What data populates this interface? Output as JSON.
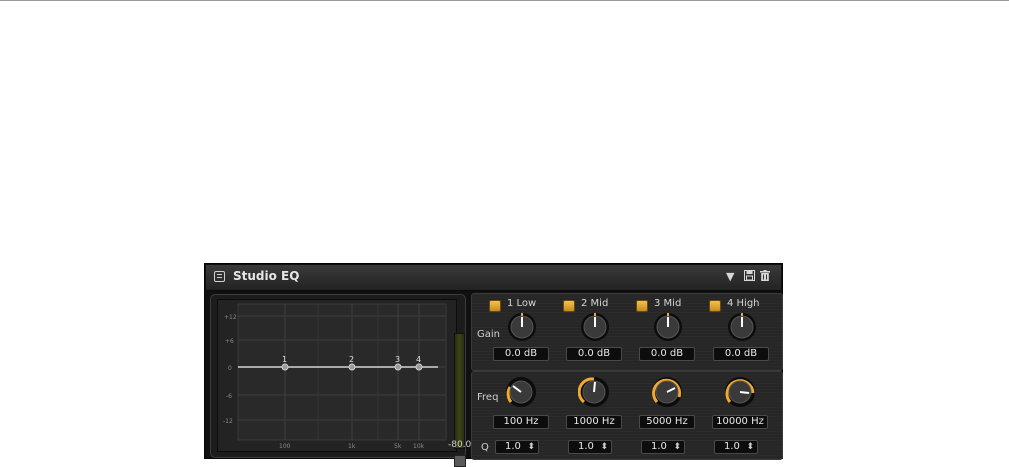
{
  "plugin": {
    "title": "Studio EQ",
    "icons": [
      "menu-icon",
      "dropdown-arrow-icon",
      "save-icon",
      "trash-icon"
    ]
  },
  "graph": {
    "db_labels": [
      "+12",
      "+6",
      "0",
      "-6",
      "-12"
    ],
    "freq_labels": [
      "100",
      "1k",
      "5k",
      "10k"
    ],
    "band_markers": [
      "1",
      "2",
      "3",
      "4"
    ],
    "meter_value": "-80.0"
  },
  "labels": {
    "gain": "Gain",
    "freq": "Freq",
    "q": "Q"
  },
  "bands": [
    {
      "name": "1 Low",
      "enabled": true,
      "gain": "0.0 dB",
      "freq": "100 Hz",
      "q": "1.0"
    },
    {
      "name": "2 Mid",
      "enabled": true,
      "gain": "0.0 dB",
      "freq": "1000 Hz",
      "q": "1.0"
    },
    {
      "name": "3 Mid",
      "enabled": true,
      "gain": "0.0 dB",
      "freq": "5000 Hz",
      "q": "1.0"
    },
    {
      "name": "4 High",
      "enabled": true,
      "gain": "0.0 dB",
      "freq": "10000 Hz",
      "q": "1.0"
    }
  ],
  "colors": {
    "accent": "#f0a830",
    "panel": "#262626",
    "background": "#101010"
  }
}
